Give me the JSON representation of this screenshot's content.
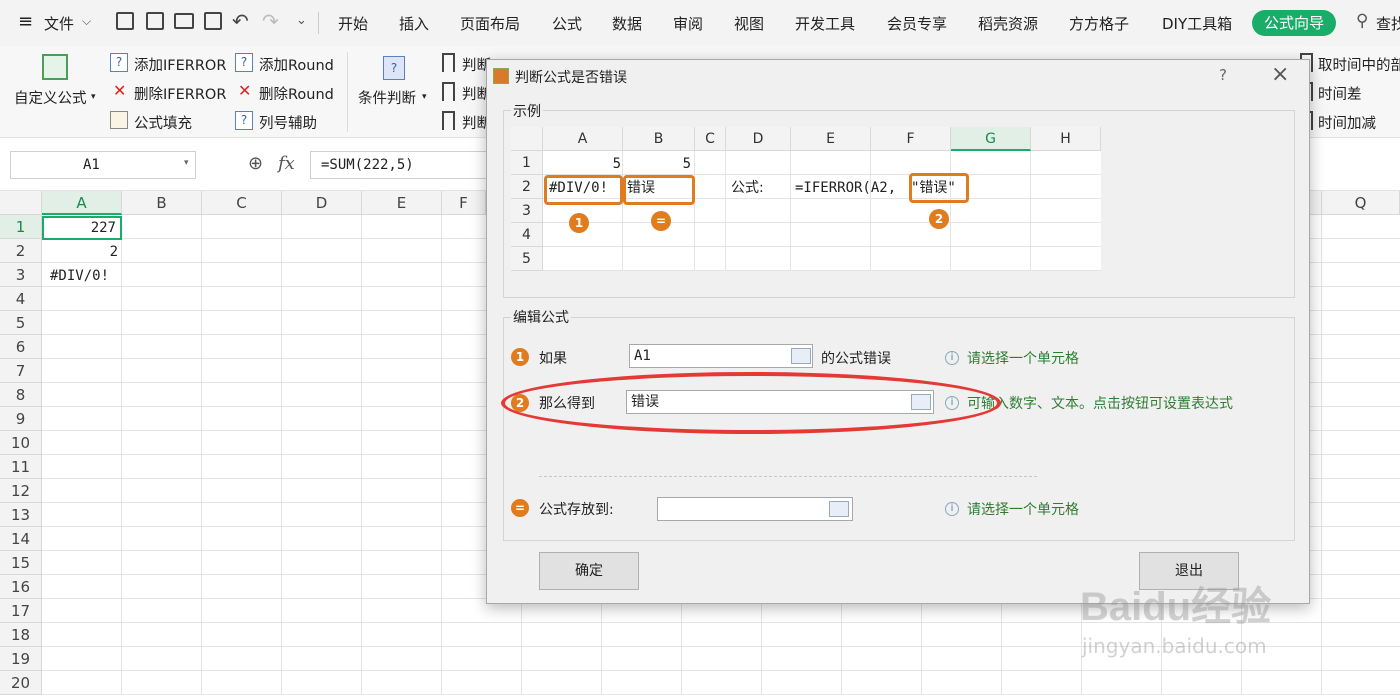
{
  "menu": {
    "file": "文件",
    "tabs": [
      "开始",
      "插入",
      "页面布局",
      "公式",
      "数据",
      "审阅",
      "视图",
      "开发工具",
      "会员专享",
      "稻壳资源",
      "方方格子",
      "DIY工具箱"
    ],
    "active_tab": "公式向导",
    "search": "查找"
  },
  "ribbon": {
    "custom_formula": "自定义公式",
    "add_iferror": "添加IFERROR",
    "delete_iferror": "删除IFERROR",
    "formula_fill": "公式填充",
    "add_round": "添加Round",
    "delete_round": "删除Round",
    "col_helper": "列号辅助",
    "condition": "条件判断",
    "judge1": "判断",
    "judge2": "判断",
    "judge3": "判断",
    "right1": "取时间中的部",
    "right2": "时间差",
    "right3": "时间加减"
  },
  "formula_bar": {
    "cell_ref": "A1",
    "formula": "=SUM(222,5)"
  },
  "sheet": {
    "columns": [
      "A",
      "B",
      "C",
      "D",
      "E",
      "F",
      "Q"
    ],
    "rows": [
      "1",
      "2",
      "3",
      "4",
      "5",
      "6",
      "7",
      "8",
      "9",
      "10",
      "11",
      "12",
      "13",
      "14",
      "15",
      "16",
      "17",
      "18",
      "19",
      "20"
    ],
    "a1": "227",
    "a2": "2",
    "a3": "#DIV/0!"
  },
  "dialog": {
    "title": "判断公式是否错误",
    "help": "?",
    "close": "×",
    "example_label": "示例",
    "example": {
      "columns": [
        "A",
        "B",
        "C",
        "D",
        "E",
        "F",
        "G",
        "H"
      ],
      "rows": [
        "1",
        "2",
        "3",
        "4",
        "5"
      ],
      "a1": "5",
      "b1": "5",
      "a2": "#DIV/0!",
      "b2": "错误",
      "formula_label": "公式:",
      "formula": "=IFERROR(A2,",
      "formula_arg": "\"错误\"",
      "badge1": "1",
      "badge_eq": "=",
      "badge2": "2"
    },
    "edit_label": "编辑公式",
    "if_label": "如果",
    "if_value": "A1",
    "if_suffix": "的公式错误",
    "if_hint": "请选择一个单元格",
    "then_label": "那么得到",
    "then_value": "错误",
    "then_hint": "可输入数字、文本。点击按钮可设置表达式",
    "store_label": "公式存放到:",
    "store_value": "",
    "store_hint": "请选择一个单元格",
    "ok": "确定",
    "exit": "退出",
    "accent_orange": "#e07b1e",
    "highlight_red": "#e53935"
  },
  "watermark": {
    "brand": "Baidu经验",
    "url": "jingyan.baidu.com"
  }
}
